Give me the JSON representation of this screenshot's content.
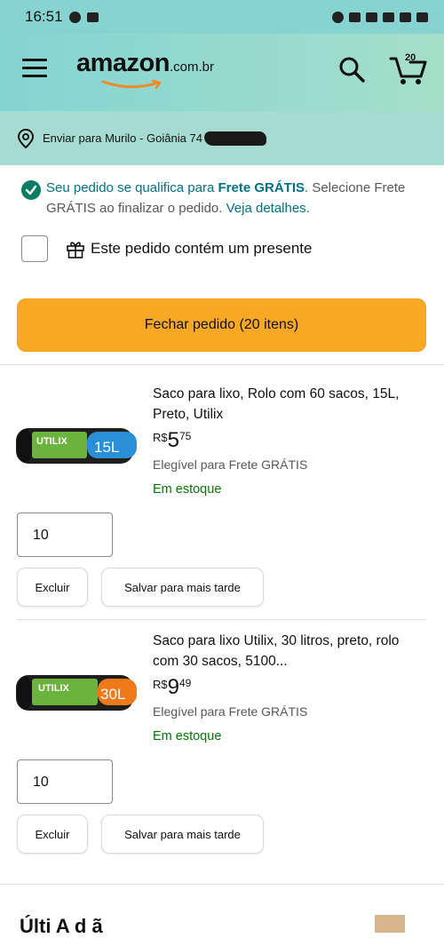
{
  "status_bar": {
    "time": "16:51"
  },
  "header": {
    "logo_main": "amazon",
    "logo_suffix": ".com.br",
    "cart_count": "20"
  },
  "delivery": {
    "text": "Enviar para Murilo - Goiânia 74"
  },
  "frete": {
    "part1": "Seu pedido se qualifica para ",
    "bold": "Frete GRÁTIS",
    "part2": ". Selecione Frete GRÁTIS ao finalizar o pedido. ",
    "link": "Veja detalhes."
  },
  "gift": {
    "label": "Este pedido contém um presente"
  },
  "checkout": {
    "label": "Fechar pedido (20 itens)"
  },
  "items": [
    {
      "title": "Saco para lixo, Rolo com 60 sacos, 15L, Preto, Utilix",
      "price_currency": "R$",
      "price_int": "5",
      "price_cents": "75",
      "eligible": "Elegível para Frete GRÁTIS",
      "stock": "Em estoque",
      "qty": "10",
      "delete_label": "Excluir",
      "save_label": "Salvar para mais tarde",
      "image_brand": "UTILIX",
      "image_size": "15L",
      "image_color": "#2a8fd6"
    },
    {
      "title": "Saco para lixo Utilix, 30 litros, preto, rolo com 30 sacos, 5100...",
      "price_currency": "R$",
      "price_int": "9",
      "price_cents": "49",
      "eligible": "Elegível para Frete GRÁTIS",
      "stock": "Em estoque",
      "qty": "10",
      "delete_label": "Excluir",
      "save_label": "Salvar para mais tarde",
      "image_brand": "UTILIX",
      "image_size": "30L",
      "image_color": "#f07a1a"
    }
  ],
  "bottom": {
    "title": "Últi  A          d    ã"
  },
  "colors": {
    "checkout": "#f8a823",
    "link": "#007185",
    "stock": "#007600",
    "header": "#84d4d3"
  }
}
